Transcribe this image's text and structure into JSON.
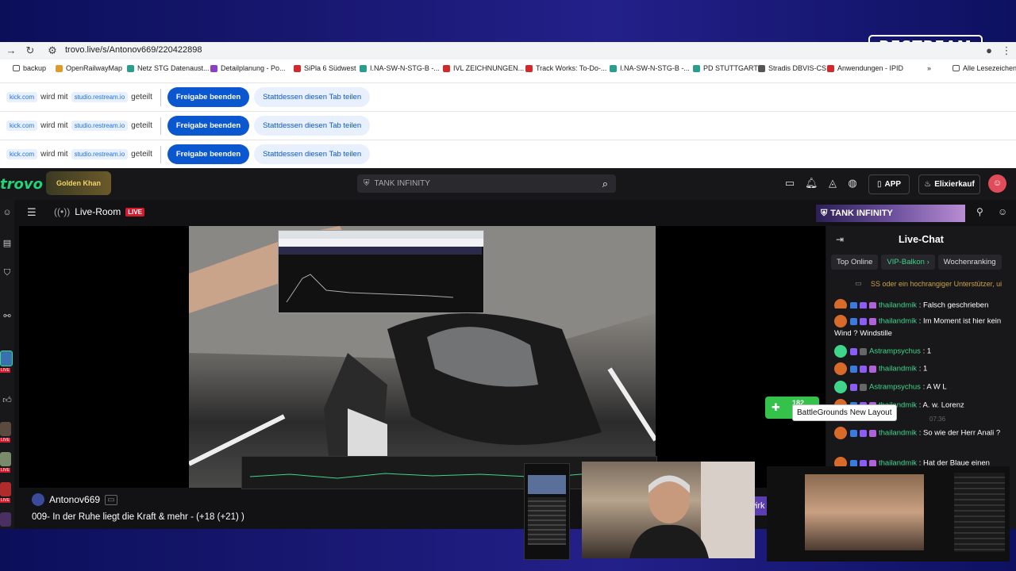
{
  "browser": {
    "url": "trovo.live/s/Antonov669/220422898",
    "bookmarks": [
      {
        "label": "backup",
        "color": "#f4b400"
      },
      {
        "label": "OpenRailwayMap",
        "color": "#e09b2d"
      },
      {
        "label": "Netz STG Datenaust...",
        "color": "#2a9d8f"
      },
      {
        "label": "Detailplanung - Po...",
        "color": "#8b3fc4"
      },
      {
        "label": "SiPla 6 Südwest",
        "color": "#d12a2a"
      },
      {
        "label": "I.NA-SW-N-STG-B -...",
        "color": "#2a9d8f"
      },
      {
        "label": "IVL ZEICHNUNGEN...",
        "color": "#d12a2a"
      },
      {
        "label": "Track Works: To-Do-...",
        "color": "#d12a2a"
      },
      {
        "label": "I.NA-SW-N-STG-B -...",
        "color": "#2a9d8f"
      },
      {
        "label": "PD STUTTGART",
        "color": "#2a9d8f"
      },
      {
        "label": "Stradis DBVIS-CS",
        "color": "#555555"
      },
      {
        "label": "Anwendungen - IPID",
        "color": "#d12a2a"
      }
    ],
    "all_bookmarks": "Alle Lesezeichen",
    "share_bars": [
      {
        "site": "kick.com",
        "mid": "wird mit",
        "studio": "studio.restream.io",
        "suffix": "geteilt",
        "stop": "Freigabe beenden",
        "share_tab": "Stattdessen diesen Tab teilen"
      },
      {
        "site": "kick.com",
        "mid": "wird mit",
        "studio": "studio.restream.io",
        "suffix": "geteilt",
        "stop": "Freigabe beenden",
        "share_tab": "Stattdessen diesen Tab teilen"
      },
      {
        "site": "kick.com",
        "mid": "wird mit",
        "studio": "studio.restream.io",
        "suffix": "geteilt",
        "stop": "Freigabe beenden",
        "share_tab": "Stattdessen diesen Tab teilen"
      }
    ]
  },
  "overlay": {
    "restream_logo": "RESTREAM"
  },
  "trovo": {
    "logo": "trovo",
    "badge": "Golden Khan",
    "search_value": "TANK INFINITY",
    "app_label": "APP",
    "elixier_label": "Elixierkauf",
    "liveroom_label": "Live-Room",
    "live_tag": "LIVE",
    "banner": "TANK INFINITY",
    "streamer": "Antonov669",
    "stream_title": "009- In der Ruhe liegt die Kraft & mehr - (+18 (+21) )",
    "video_overlay_fragment": "wirk"
  },
  "chat": {
    "title": "Live-Chat",
    "tabs": [
      "Top Online",
      "VIP-Balkon ›",
      "Wochenranking"
    ],
    "notice": "SS oder ein hochrangiger Unterstützer, ui",
    "messages": [
      {
        "user": "thailandmik",
        "text": "Falsch geschrieben",
        "avatar": "#d96b2a"
      },
      {
        "user": "thailandmik",
        "text": "Im Moment ist hier kein Wind ? Windstille",
        "avatar": "#d96b2a"
      },
      {
        "user": "Astrampsychus",
        "text": "1",
        "avatar": "#3fd58a"
      },
      {
        "user": "thailandmik",
        "text": "1",
        "avatar": "#d96b2a"
      },
      {
        "user": "Astrampsychus",
        "text": "A W L",
        "avatar": "#3fd58a"
      },
      {
        "user": "thailandmik",
        "text": "A. w. Lorenz",
        "avatar": "#d96b2a"
      },
      {
        "user": "thailandmik",
        "text": "So wie der Herr Anali ?",
        "avatar": "#d96b2a"
      },
      {
        "user": "thailandmik",
        "text": "Hat der Blaue einen",
        "avatar": "#d96b2a"
      }
    ],
    "timestamp": "07:36",
    "gift_count": "182",
    "tooltip": "BattleGrounds New Layout"
  }
}
